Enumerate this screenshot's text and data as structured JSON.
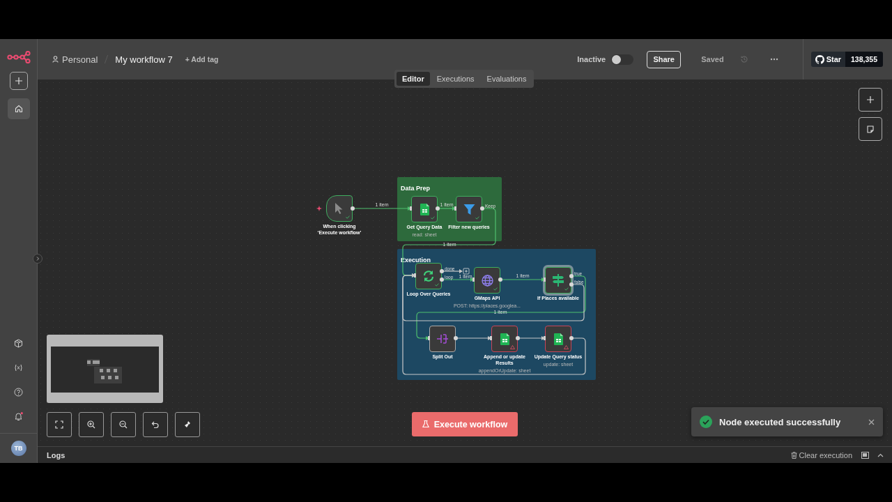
{
  "sidebar": {
    "top_items": [
      {
        "kind": "create",
        "selected": false
      },
      {
        "kind": "home",
        "selected": true
      }
    ],
    "bottom_items": [
      {
        "kind": "templates",
        "unread": false
      },
      {
        "kind": "variables",
        "unread": false
      },
      {
        "kind": "help",
        "unread": false
      },
      {
        "kind": "notifications",
        "unread": true
      }
    ],
    "avatar": "TB"
  },
  "header": {
    "project": "Personal",
    "workflow": "My workflow 7",
    "add_tag": "+ Add tag",
    "status_label": "Inactive",
    "active": false,
    "share": "Share",
    "save_state": "Saved",
    "github": {
      "label": "Star",
      "count": "138,355"
    }
  },
  "tabs": [
    {
      "label": "Editor",
      "selected": true
    },
    {
      "label": "Executions",
      "selected": false
    },
    {
      "label": "Evaluations",
      "selected": false
    }
  ],
  "canvas": {
    "groups": [
      {
        "title": "Data Prep",
        "color": "#2d6a3c"
      },
      {
        "title": "Execution",
        "color": "#1d4862"
      }
    ],
    "nodes": [
      {
        "name": "When clicking ‘Execute workflow’",
        "kind": "trigger",
        "executed": true,
        "has_issues": false,
        "selected": false
      },
      {
        "name": "Get Query Data",
        "subtitle": "read: sheet",
        "kind": "sheet",
        "executed": true,
        "has_issues": false,
        "selected": false
      },
      {
        "name": "Filter new queries",
        "kind": "filter",
        "executed": true,
        "has_issues": false,
        "selected": false,
        "output_labels": [
          "Keep"
        ]
      },
      {
        "name": "Loop Over Queries",
        "kind": "loop",
        "executed": true,
        "has_issues": false,
        "selected": false,
        "output_labels": [
          "done",
          "loop"
        ]
      },
      {
        "name": "GMaps API",
        "subtitle": "POST: https://places.googlea...",
        "kind": "http",
        "executed": true,
        "has_issues": false,
        "selected": false
      },
      {
        "name": "If Places available",
        "kind": "if",
        "executed": true,
        "has_issues": false,
        "selected": true,
        "output_labels": [
          "true",
          "false"
        ]
      },
      {
        "name": "Split Out",
        "kind": "split",
        "executed": false,
        "has_issues": false,
        "selected": false
      },
      {
        "name": "Append or update Results",
        "subtitle": "appendOrUpdate: sheet",
        "kind": "sheet",
        "executed": false,
        "has_issues": true,
        "selected": false
      },
      {
        "name": "Update Query status",
        "subtitle": "update: sheet",
        "kind": "sheet",
        "executed": false,
        "has_issues": true,
        "selected": false
      }
    ],
    "edges": [
      {
        "label": "1 item",
        "executed": true
      },
      {
        "label": "1 item",
        "executed": true
      },
      {
        "label": "1 item",
        "executed": true
      },
      {
        "executed": false
      },
      {
        "label": "1 item",
        "executed": true
      },
      {
        "label": "1 item",
        "executed": true
      },
      {
        "label": "1 item",
        "executed": true
      },
      {
        "executed": false
      },
      {
        "executed": false
      },
      {
        "executed": false
      },
      {
        "executed": false
      }
    ]
  },
  "execute_button": "Execute workflow",
  "toast": {
    "message": "Node executed successfully"
  },
  "logs": {
    "title": "Logs",
    "clear": "Clear execution"
  }
}
